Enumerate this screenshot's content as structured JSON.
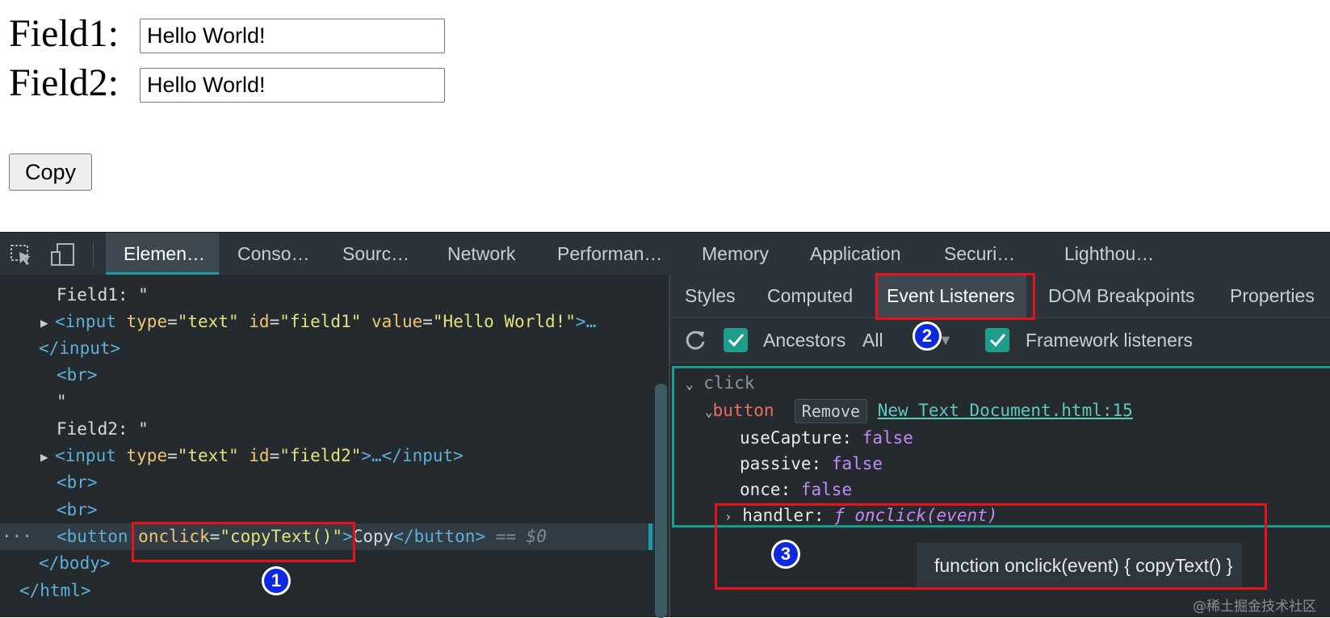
{
  "page": {
    "field1_label": "Field1:",
    "field1_value": "Hello World!",
    "field2_label": "Field2:",
    "field2_value": "Hello World!",
    "copy_button": "Copy"
  },
  "devtools": {
    "main_tabs": [
      "Elemen…",
      "Conso…",
      "Sourc…",
      "Network",
      "Performan…",
      "Memory",
      "Application",
      "Securi…",
      "Lighthou…"
    ],
    "active_tab": "Elemen…",
    "dom": {
      "field1_text": "Field1: \"",
      "input1_tag": "<input",
      "input1_attrs": [
        {
          "name": "type",
          "value": "\"text\""
        },
        {
          "name": "id",
          "value": "\"field1\""
        },
        {
          "name": "value",
          "value": "\"Hello World!\""
        }
      ],
      "input1_end": ">…",
      "input_close": "</input>",
      "br": "<br>",
      "quote": "\"",
      "field2_text": "Field2: \"",
      "input2_tag": "<input",
      "input2_attrs": [
        {
          "name": "type",
          "value": "\"text\""
        },
        {
          "name": "id",
          "value": "\"field2\""
        }
      ],
      "input2_end": ">…</input>",
      "button_tag": "<button",
      "button_attr_name": "onclick",
      "button_attr_value": "\"copyText()\"",
      "button_text": "Copy",
      "button_close": "</button>",
      "selected_marker": "== $0",
      "body_close": "</body>",
      "html_close": "</html>",
      "dots": "···"
    },
    "sidebar_tabs": [
      "Styles",
      "Computed",
      "Event Listeners",
      "DOM Breakpoints",
      "Properties"
    ],
    "active_sidebar_tab": "Event Listeners",
    "options": {
      "ancestors_label": "Ancestors",
      "filter_value": "All",
      "framework_label": "Framework listeners"
    },
    "listeners": {
      "event": "click",
      "target": "button",
      "remove_label": "Remove",
      "source_link": "New Text Document.html:15",
      "props": [
        {
          "key": "useCapture",
          "value": "false"
        },
        {
          "key": "passive",
          "value": "false"
        },
        {
          "key": "once",
          "value": "false"
        }
      ],
      "handler_key": "handler",
      "handler_value": "ƒ onclick(event)",
      "tooltip": "function onclick(event) { copyText() }"
    }
  },
  "annotations": {
    "badges": [
      "1",
      "2",
      "3"
    ],
    "accent_color": "#e8121a",
    "badge_color": "#0e2ae0"
  },
  "watermark": "@稀土掘金技术社区"
}
